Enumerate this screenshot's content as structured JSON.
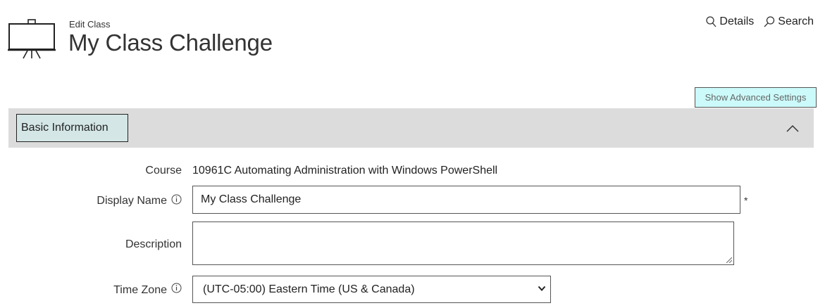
{
  "header": {
    "subtitle": "Edit Class",
    "title": "My Class Challenge",
    "icon": "presentation-board-icon"
  },
  "top_links": {
    "details_label": "Details",
    "search_label": "Search"
  },
  "advanced_settings_label": "Show Advanced Settings",
  "section": {
    "tab_label": "Basic Information",
    "collapse_icon": "chevron-up-icon"
  },
  "form": {
    "course_label": "Course",
    "course_value": "10961C Automating Administration with Windows PowerShell",
    "display_name_label": "Display Name",
    "display_name_value": "My Class Challenge",
    "required_marker": "*",
    "description_label": "Description",
    "description_value": "",
    "time_zone_label": "Time Zone",
    "time_zone_value": "(UTC-05:00) Eastern Time (US & Canada)"
  },
  "colors": {
    "advanced_button_bg": "#ccfafa",
    "section_bar_bg": "#dcdcdc",
    "section_tab_bg": "#d4e6e6"
  }
}
